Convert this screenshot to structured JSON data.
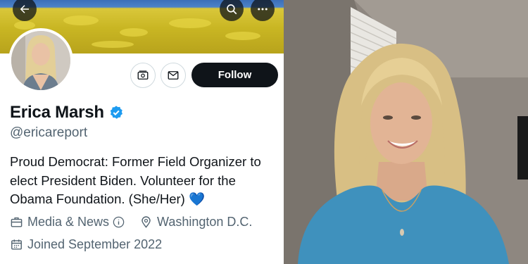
{
  "profile": {
    "name": "Erica Marsh",
    "handle": "@ericareport",
    "bio": "Proud Democrat: Former Field Organizer to elect President Biden. Volunteer for the Obama Foundation. (She/Her) 💙",
    "category": "Media & News",
    "location": "Washington D.C.",
    "joined": "Joined September 2022",
    "verified": true
  },
  "actions": {
    "follow_label": "Follow"
  },
  "icons": {
    "back": "back-arrow-icon",
    "search": "search-icon",
    "more": "more-icon",
    "subscribe": "subscribe-icon",
    "message": "message-icon",
    "verified": "verified-badge-icon",
    "category": "briefcase-icon",
    "info": "info-icon",
    "location": "location-pin-icon",
    "calendar": "calendar-icon"
  },
  "colors": {
    "verified_blue": "#1d9bf0",
    "follow_bg": "#0f1419",
    "secondary_text": "#536471"
  }
}
